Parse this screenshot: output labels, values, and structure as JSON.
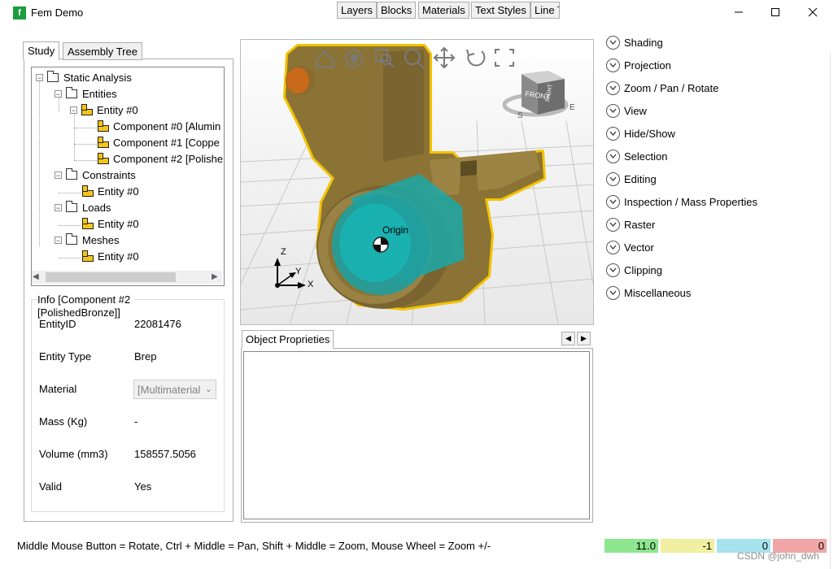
{
  "window": {
    "title": "Fem Demo",
    "icon_letter": "f"
  },
  "left_tabs": {
    "study": "Study",
    "assembly_tree": "Assembly Tree"
  },
  "tree": {
    "root": "Static Analysis",
    "entities": "Entities",
    "entity0": "Entity #0",
    "components": [
      "Component #0 [Alumin",
      "Component #1 [Coppe",
      "Component #2 [Polishe"
    ],
    "constraints": "Constraints",
    "constraints_entity": "Entity #0",
    "loads": "Loads",
    "loads_entity": "Entity #0",
    "meshes": "Meshes",
    "meshes_entity": "Entity #0"
  },
  "info": {
    "title_line1": "Info [Component #2",
    "title_line2": "[PolishedBronze]]",
    "rows": [
      {
        "label": "EntityID",
        "value": "22081476"
      },
      {
        "label": "Entity Type",
        "value": "Brep"
      },
      {
        "label": "Material",
        "value": "[Multimaterial"
      },
      {
        "label": "Mass (Kg)",
        "value": "-"
      },
      {
        "label": "Volume (mm3)",
        "value": "158557.5056"
      },
      {
        "label": "Valid",
        "value": "Yes"
      }
    ]
  },
  "viewport": {
    "origin_label": "Origin",
    "axes": {
      "x": "X",
      "y": "Y",
      "z": "Z"
    },
    "viewcube": {
      "front": "FRONT",
      "right": "RIGHT",
      "compass": [
        "S",
        "E"
      ]
    },
    "toolbar_icons": [
      "home-icon",
      "zoom-window-icon",
      "zoom-extents-icon",
      "zoom-icon",
      "pan-icon",
      "rotate-icon",
      "fullscreen-icon"
    ],
    "model_color": "#8b7335",
    "selection_color": "#f2c200",
    "cylinder_color": "#1aa8a8"
  },
  "bottom_tabs": [
    "Object Proprieties",
    "Layers",
    "Blocks",
    "Materials",
    "Text Styles",
    "Line T"
  ],
  "accordion": [
    "Shading",
    "Projection",
    "Zoom / Pan / Rotate",
    "View",
    "Hide/Show",
    "Selection",
    "Editing",
    "Inspection / Mass Properties",
    "Raster",
    "Vector",
    "Clipping",
    "Miscellaneous"
  ],
  "status": {
    "hint": "Middle Mouse Button = Rotate, Ctrl + Middle = Pan, Shift + Middle = Zoom, Mouse Wheel = Zoom +/-",
    "boxes": [
      {
        "value": "11.0",
        "color": "#8ee68e"
      },
      {
        "value": "-1",
        "color": "#f0f0a0"
      },
      {
        "value": "0",
        "color": "#a6e3ee"
      },
      {
        "value": "0",
        "color": "#f0a6a6"
      }
    ]
  },
  "watermark": "CSDN @john_dwh"
}
